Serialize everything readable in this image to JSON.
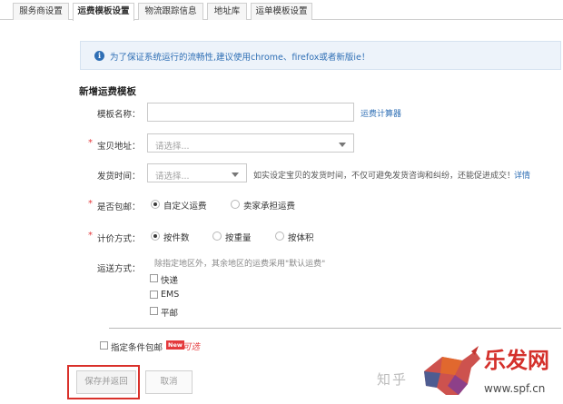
{
  "tabs": [
    {
      "label": "服务商设置"
    },
    {
      "label": "运费模板设置"
    },
    {
      "label": "物流跟踪信息"
    },
    {
      "label": "地址库"
    },
    {
      "label": "运单模板设置"
    }
  ],
  "notice": {
    "text": "为了保证系统运行的流畅性,建议使用chrome、firefox或者新版ie！"
  },
  "section_title": "新增运费模板",
  "form": {
    "template_name": {
      "label": "模板名称：",
      "value": "",
      "link": "运费计算器"
    },
    "origin": {
      "label": "宝贝地址：",
      "placeholder": "请选择..."
    },
    "ship_time": {
      "label": "发货时间：",
      "placeholder": "请选择...",
      "hint": "如实设定宝贝的发货时间，不仅可避免发货咨询和纠纷，还能促进成交！",
      "hint_link": "详情"
    },
    "free_shipping": {
      "label": "是否包邮：",
      "options": [
        {
          "label": "自定义运费"
        },
        {
          "label": "卖家承担运费"
        }
      ]
    },
    "pricing": {
      "label": "计价方式：",
      "options": [
        {
          "label": "按件数"
        },
        {
          "label": "按重量"
        },
        {
          "label": "按体积"
        }
      ]
    },
    "delivery": {
      "label": "运送方式：",
      "hint": "除指定地区外，其余地区的运费采用\"默认运费\"",
      "options": [
        {
          "label": "快递"
        },
        {
          "label": "EMS"
        },
        {
          "label": "平邮"
        }
      ]
    },
    "conditional_free": {
      "label": "指定条件包邮",
      "badge": "New",
      "tag": "可选"
    }
  },
  "buttons": {
    "save": "保存并返回",
    "cancel": "取消"
  },
  "watermark": {
    "text1": "知乎",
    "text2": "乐发网",
    "text3": "www.spf.cn"
  },
  "colors": {
    "accent_blue": "#2f6fb5",
    "required_red": "#e4393c",
    "highlight_red": "#d9302a"
  }
}
